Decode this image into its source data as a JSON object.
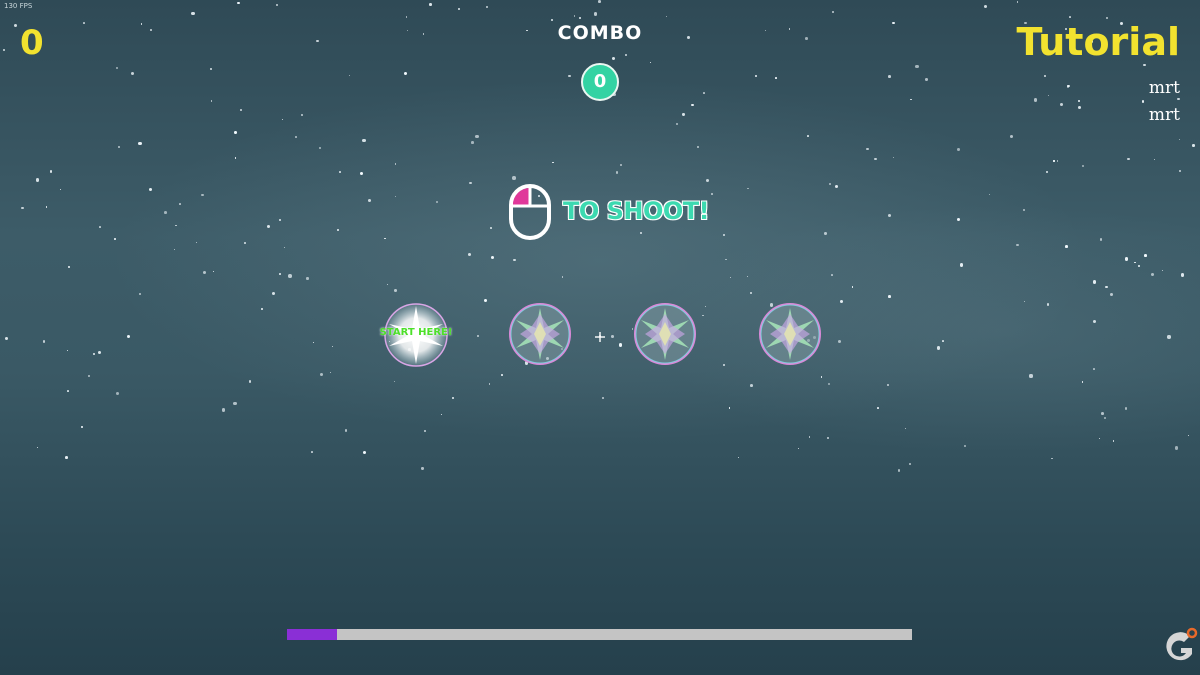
{
  "hud": {
    "fps_label": "130 FPS",
    "score": "0",
    "combo_label": "COMBO",
    "combo_value": "0",
    "level_title": "Tutorial",
    "player_names": [
      "mrt",
      "mrt"
    ]
  },
  "instruction": {
    "icon": "mouse-left-click-icon",
    "text": "TO SHOOT!"
  },
  "targets": {
    "start_label": "START HERE!",
    "count": 4
  },
  "progress": {
    "fraction": 0.08
  },
  "colors": {
    "score_yellow": "#f2e22f",
    "combo_green": "#33d3a3",
    "shoot_text": "#3cd9b0",
    "mouse_button": "#e0389a",
    "start_label_green": "#4de02a",
    "progress_fill": "#8a2fd6",
    "progress_track": "#c4c4c4"
  }
}
